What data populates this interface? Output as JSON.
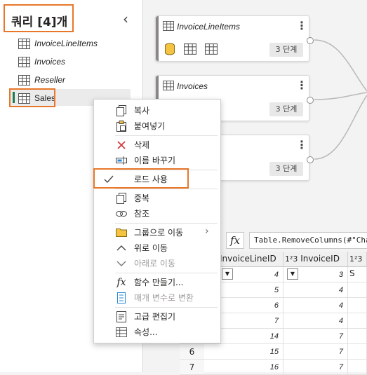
{
  "queries_pane": {
    "title": "쿼리 [4]개",
    "collapse_glyph": "‹",
    "items": [
      {
        "label": "InvoiceLineItems"
      },
      {
        "label": "Invoices"
      },
      {
        "label": "Reseller"
      },
      {
        "label": "Sales"
      }
    ]
  },
  "diagram": {
    "cards": [
      {
        "title": "InvoiceLineItems",
        "steps": "3 단계"
      },
      {
        "title": "Invoices",
        "steps": "3 단계"
      },
      {
        "title": "",
        "steps": "3 단계"
      }
    ]
  },
  "formula_bar": {
    "fx": "fx",
    "text": "Table.RemoveColumns(#\"Cha"
  },
  "grid": {
    "columns": [
      {
        "label": "InvoiceLineID",
        "type_icon": ""
      },
      {
        "label": "InvoiceID",
        "type_icon": "1²3"
      },
      {
        "label": "S",
        "type_icon": "1²3"
      }
    ],
    "rows": [
      {
        "row": "",
        "c1": "4",
        "c2": "3"
      },
      {
        "row": "",
        "c1": "5",
        "c2": "4"
      },
      {
        "row": "",
        "c1": "6",
        "c2": "4"
      },
      {
        "row": "",
        "c1": "7",
        "c2": "4"
      },
      {
        "row": "",
        "c1": "14",
        "c2": "7"
      },
      {
        "row": "6",
        "c1": "15",
        "c2": "7"
      },
      {
        "row": "7",
        "c1": "16",
        "c2": "7"
      }
    ]
  },
  "context_menu": {
    "items": {
      "copy": "복사",
      "paste": "붙여넣기",
      "delete": "삭제",
      "rename": "이름 바꾸기",
      "enable_load": "로드 사용",
      "duplicate": "중복",
      "reference": "참조",
      "move_to_group": "그룹으로 이동",
      "move_up": "위로 이동",
      "move_down": "아래로 이동",
      "create_function": "함수 만들기...",
      "convert_to_parameter": "매개 변수로 변환",
      "advanced_editor": "고급 편집기",
      "properties": "속성..."
    }
  },
  "colors": {
    "highlight": "#e8772a",
    "selected_bar": "#1a7a55",
    "delete_x": "#d13438"
  }
}
